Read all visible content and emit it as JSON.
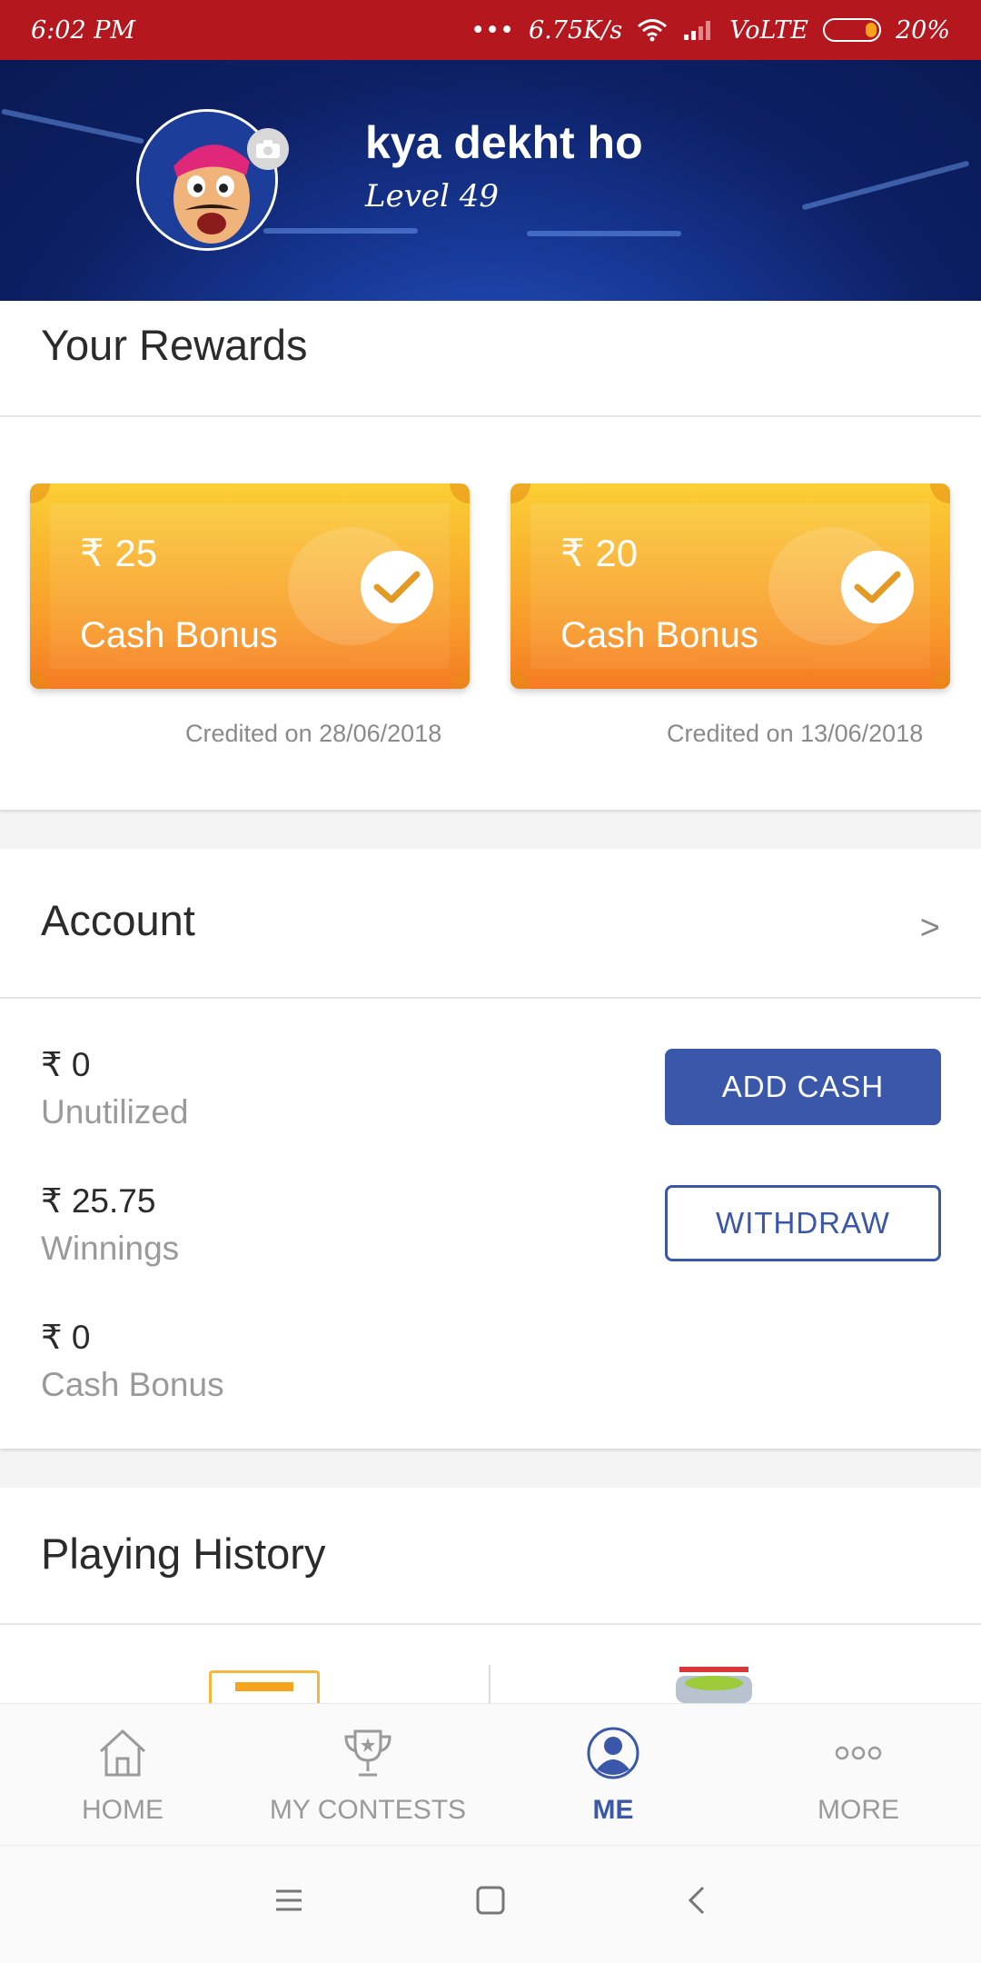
{
  "status_bar": {
    "time": "6:02 PM",
    "network_speed": "6.75K/s",
    "network_type": "VoLTE",
    "battery": "20%",
    "battery_level": 0.2
  },
  "profile": {
    "name": "kya dekht ho",
    "level": "Level 49"
  },
  "rewards": {
    "title": "Your Rewards",
    "items": [
      {
        "amount": "₹ 25",
        "label": "Cash Bonus",
        "credited": "Credited on 28/06/2018"
      },
      {
        "amount": "₹ 20",
        "label": "Cash Bonus",
        "credited": "Credited on 13/06/2018"
      }
    ]
  },
  "account": {
    "title": "Account",
    "chevron": ">",
    "balances": [
      {
        "amount": "₹ 0",
        "label": "Unutilized"
      },
      {
        "amount": "₹ 25.75",
        "label": "Winnings"
      },
      {
        "amount": "₹ 0",
        "label": "Cash Bonus"
      }
    ],
    "add_cash_label": "ADD CASH",
    "withdraw_label": "WITHDRAW"
  },
  "history": {
    "title": "Playing History"
  },
  "bottom_nav": {
    "items": [
      {
        "label": "HOME",
        "icon": "home-icon"
      },
      {
        "label": "MY CONTESTS",
        "icon": "trophy-icon"
      },
      {
        "label": "ME",
        "icon": "user-icon",
        "active": true
      },
      {
        "label": "MORE",
        "icon": "more-icon"
      }
    ]
  },
  "colors": {
    "status_bar": "#b5171f",
    "brand_blue": "#3a57a9",
    "ticket_top": "#fbcf34",
    "ticket_bottom": "#f57a24"
  }
}
